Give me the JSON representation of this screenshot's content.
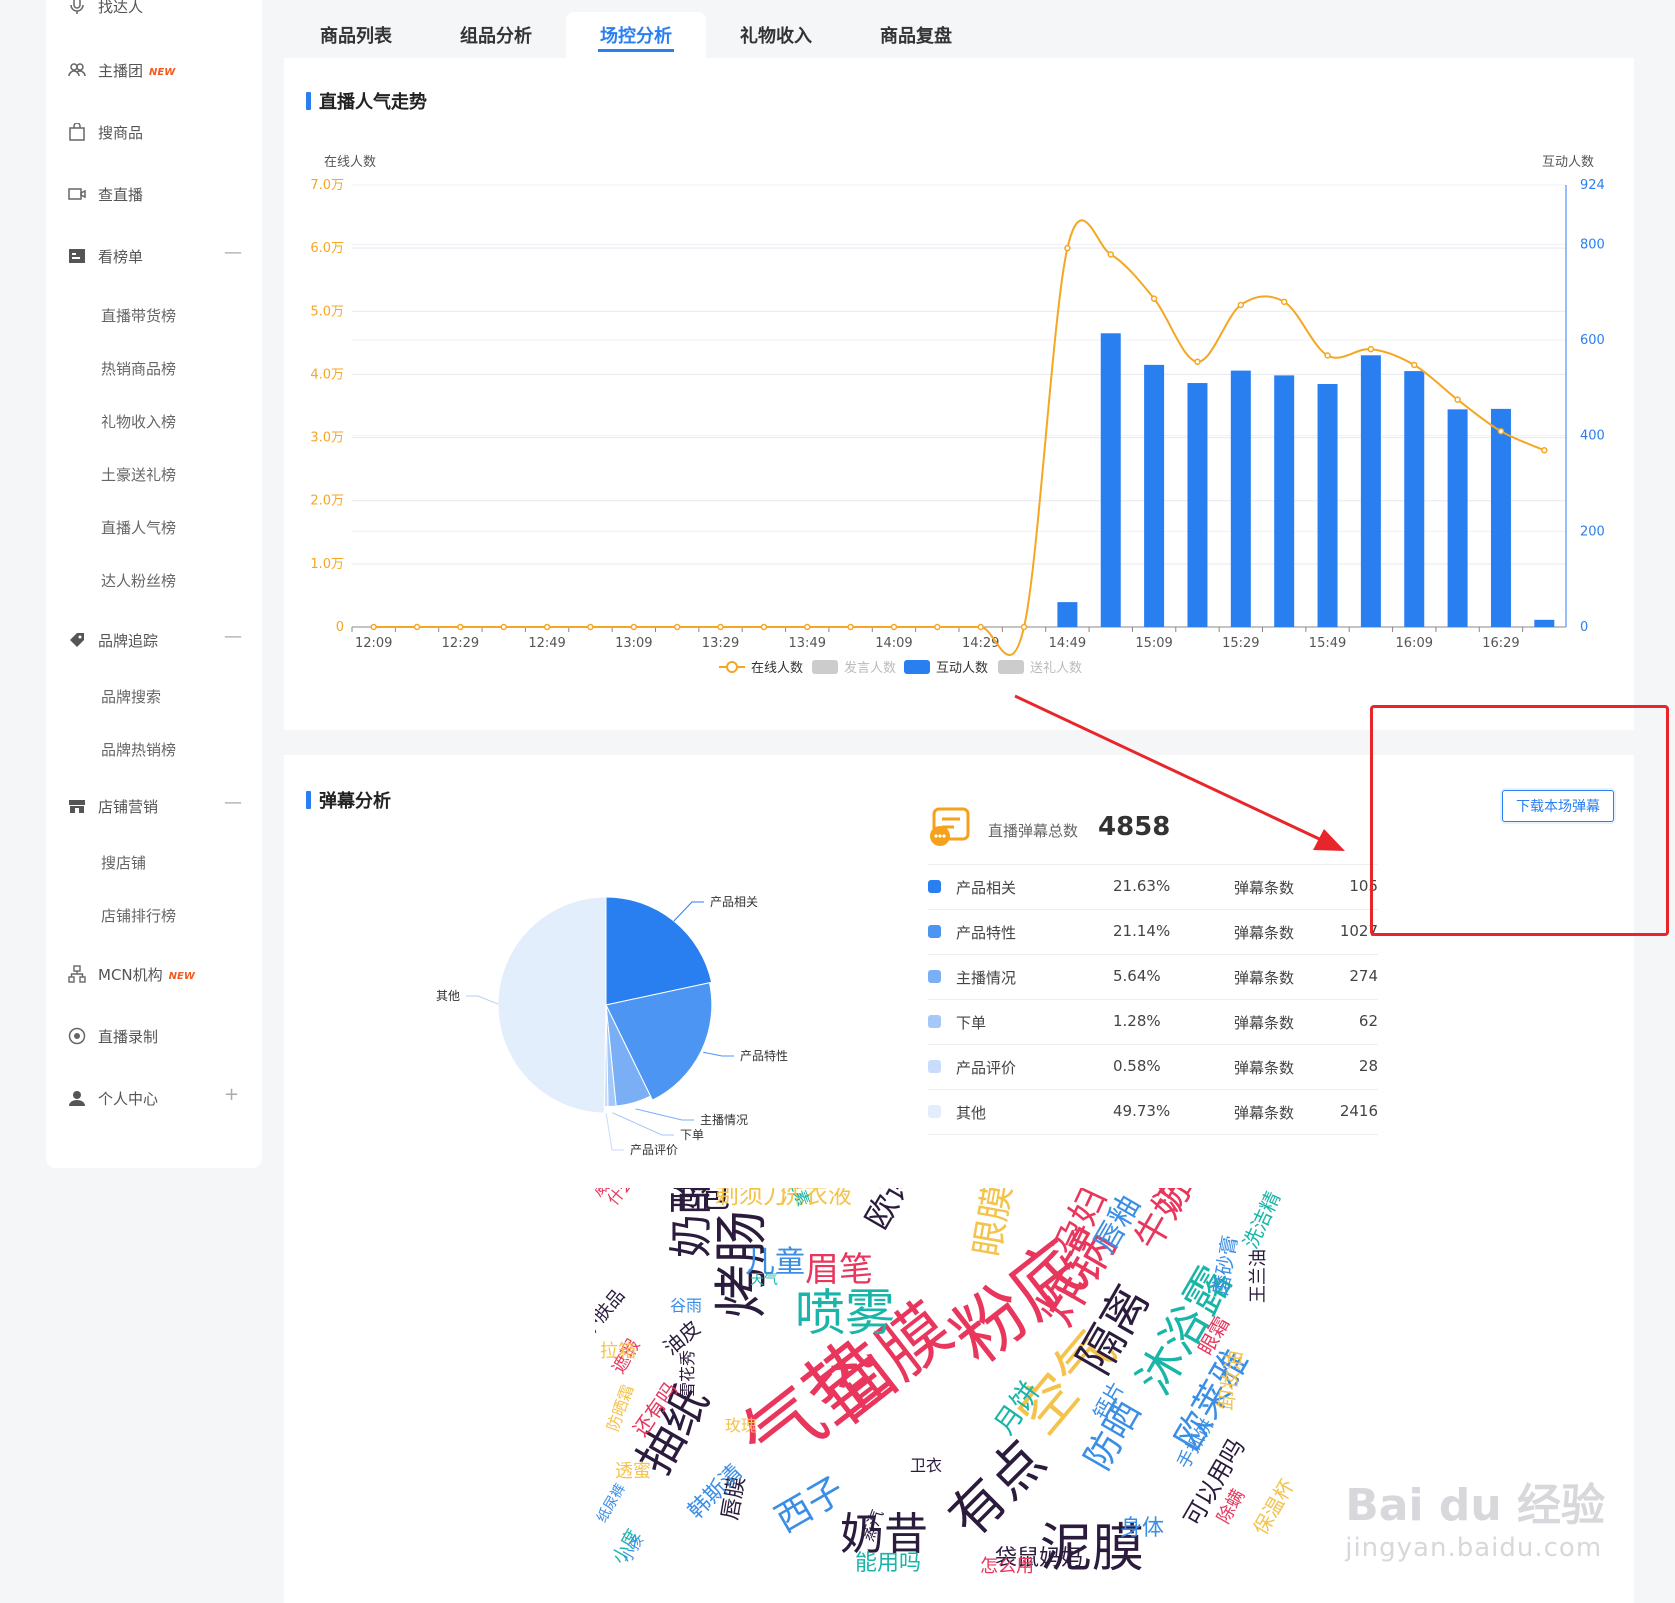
{
  "sidebar": {
    "items": [
      {
        "label": "找达人",
        "icon": "mic-icon"
      },
      {
        "label": "主播团",
        "icon": "group-icon",
        "badge": "NEW"
      },
      {
        "label": "搜商品",
        "icon": "bag-icon"
      },
      {
        "label": "查直播",
        "icon": "video-icon"
      },
      {
        "label": "看榜单",
        "icon": "ranking-icon",
        "toggle": "—"
      },
      {
        "label": "直播带货榜"
      },
      {
        "label": "热销商品榜"
      },
      {
        "label": "礼物收入榜"
      },
      {
        "label": "土豪送礼榜"
      },
      {
        "label": "直播人气榜"
      },
      {
        "label": "达人粉丝榜"
      },
      {
        "label": "品牌追踪",
        "icon": "tag-icon",
        "toggle": "—"
      },
      {
        "label": "品牌搜索"
      },
      {
        "label": "品牌热销榜"
      },
      {
        "label": "店铺营销",
        "icon": "store-icon",
        "toggle": "—"
      },
      {
        "label": "搜店铺"
      },
      {
        "label": "店铺排行榜"
      },
      {
        "label": "MCN机构",
        "icon": "org-icon",
        "badge": "NEW"
      },
      {
        "label": "直播录制",
        "icon": "record-icon"
      },
      {
        "label": "个人中心",
        "icon": "user-icon",
        "toggle": "+"
      }
    ]
  },
  "tabs": [
    "商品列表",
    "组品分析",
    "场控分析",
    "礼物收入",
    "商品复盘"
  ],
  "popularity": {
    "title": "直播人气走势",
    "left_axis_label": "在线人数",
    "right_axis_label": "互动人数",
    "legend": [
      "在线人数",
      "发言人数",
      "互动人数",
      "送礼人数"
    ]
  },
  "chart_data": {
    "type": "bar",
    "x": [
      "12:09",
      "12:19",
      "12:29",
      "12:39",
      "12:49",
      "12:59",
      "13:09",
      "13:19",
      "13:29",
      "13:39",
      "13:49",
      "13:59",
      "14:09",
      "14:19",
      "14:29",
      "14:39",
      "14:49",
      "14:59",
      "15:09",
      "15:19",
      "15:29",
      "15:39",
      "15:49",
      "15:59",
      "16:09",
      "16:19",
      "16:29",
      "16:39"
    ],
    "xticks": [
      "12:09",
      "12:29",
      "12:49",
      "13:09",
      "13:29",
      "13:49",
      "14:09",
      "14:29",
      "14:49",
      "15:09",
      "15:29",
      "15:49",
      "16:09",
      "16:29"
    ],
    "yleft_ticks": [
      "0",
      "1.0万",
      "2.0万",
      "3.0万",
      "4.0万",
      "5.0万",
      "6.0万",
      "7.0万"
    ],
    "yleft_lim": [
      0,
      70000
    ],
    "yright_ticks": [
      "0",
      "200",
      "400",
      "600",
      "800",
      "924"
    ],
    "yright_lim": [
      0,
      924
    ],
    "series": [
      {
        "name": "在线人数",
        "kind": "line",
        "axis": "left",
        "values": [
          0,
          0,
          0,
          0,
          0,
          0,
          0,
          0,
          0,
          0,
          0,
          0,
          0,
          0,
          0,
          0,
          60000,
          59000,
          52000,
          42000,
          51000,
          51500,
          43000,
          44000,
          41500,
          36000,
          31000,
          28000
        ]
      },
      {
        "name": "互动人数",
        "kind": "bar",
        "axis": "right",
        "values": [
          0,
          0,
          0,
          0,
          0,
          0,
          0,
          0,
          0,
          0,
          0,
          0,
          0,
          0,
          0,
          0,
          52,
          614,
          548,
          510,
          536,
          526,
          508,
          568,
          535,
          455,
          456,
          15
        ]
      }
    ]
  },
  "danmu": {
    "title": "弹幕分析",
    "total_label": "直播弹幕总数",
    "total_value": "4858",
    "download_label": "下载本场弹幕",
    "rows": [
      {
        "name": "产品相关",
        "pct": "21.63%",
        "label": "弹幕条数",
        "count": "105",
        "color": "#2a7ff0"
      },
      {
        "name": "产品特性",
        "pct": "21.14%",
        "label": "弹幕条数",
        "count": "1027",
        "color": "#4d95f3"
      },
      {
        "name": "主播情况",
        "pct": "5.64%",
        "label": "弹幕条数",
        "count": "274",
        "color": "#7aaff6"
      },
      {
        "name": "下单",
        "pct": "1.28%",
        "label": "弹幕条数",
        "count": "62",
        "color": "#a3c8f9"
      },
      {
        "name": "产品评价",
        "pct": "0.58%",
        "label": "弹幕条数",
        "count": "28",
        "color": "#c7ddfb"
      },
      {
        "name": "其他",
        "pct": "49.73%",
        "label": "弹幕条数",
        "count": "2416",
        "color": "#e3eefd"
      }
    ],
    "pie_labels": [
      "产品相关",
      "产品特性",
      "主播情况",
      "下单",
      "产品评价",
      "其他"
    ],
    "pie_values": [
      21.63,
      21.14,
      5.64,
      1.28,
      0.58,
      49.73
    ],
    "pie_colors": [
      "#2a7ff0",
      "#4d95f3",
      "#7aaff6",
      "#a3c8f9",
      "#c7ddfb",
      "#e3eefd"
    ]
  },
  "wordcloud": {
    "words": [
      {
        "t": "气垫",
        "c": "#e8365d"
      },
      {
        "t": "面膜",
        "c": "#e8365d"
      },
      {
        "t": "粉底",
        "c": "#e8365d"
      },
      {
        "t": "烤肠",
        "c": "#2b1b3d"
      },
      {
        "t": "喷雾",
        "c": "#19b5a8"
      },
      {
        "t": "奶酪",
        "c": "#2b1b3d"
      },
      {
        "t": "空气",
        "c": "#f4c34c"
      },
      {
        "t": "炸锅",
        "c": "#e8365d"
      },
      {
        "t": "隔离",
        "c": "#2b1b3d"
      },
      {
        "t": "沐浴露",
        "c": "#19b5a8"
      },
      {
        "t": "泥膜",
        "c": "#2b1b3d"
      },
      {
        "t": "奶昔",
        "c": "#2b1b3d"
      },
      {
        "t": "有点",
        "c": "#2b1b3d"
      },
      {
        "t": "抽纸",
        "c": "#2b1b3d"
      },
      {
        "t": "防晒",
        "c": "#3a8ee6"
      },
      {
        "t": "眉笔",
        "c": "#e8365d"
      },
      {
        "t": "眼膜",
        "c": "#f4c34c"
      },
      {
        "t": "孕妇",
        "c": "#e8365d"
      },
      {
        "t": "牛奶",
        "c": "#e8365d"
      },
      {
        "t": "洗手液",
        "c": "#e8365d"
      },
      {
        "t": "儿童",
        "c": "#3a8ee6"
      },
      {
        "t": "书包",
        "c": "#2b1b3d"
      },
      {
        "t": "欧诗漫",
        "c": "#2b1b3d"
      },
      {
        "t": "西子",
        "c": "#3a8ee6"
      },
      {
        "t": "欧莱雅",
        "c": "#3a8ee6"
      },
      {
        "t": "唇釉",
        "c": "#3a8ee6"
      },
      {
        "t": "洗衣液",
        "c": "#f4c34c"
      },
      {
        "t": "剃须刀",
        "c": "#f4c34c"
      },
      {
        "t": "月饼",
        "c": "#19b5a8"
      },
      {
        "t": "袋鼠妈妈",
        "c": "#2b1b3d"
      },
      {
        "t": "能用吗",
        "c": "#19b5a8"
      },
      {
        "t": "怎么用",
        "c": "#e8365d"
      },
      {
        "t": "身体",
        "c": "#3a8ee6"
      },
      {
        "t": "可以用吗",
        "c": "#2b1b3d"
      },
      {
        "t": "小度",
        "c": "#19b5a8"
      },
      {
        "t": "唇膜",
        "c": "#2b1b3d"
      },
      {
        "t": "韩斯清",
        "c": "#3a8ee6"
      },
      {
        "t": "还有吗",
        "c": "#e8365d"
      },
      {
        "t": "遮瑕",
        "c": "#e8365d"
      },
      {
        "t": "透蜜",
        "c": "#f4c34c"
      },
      {
        "t": "防晒霜",
        "c": "#f4c34c"
      },
      {
        "t": "拉箱",
        "c": "#f4c34c"
      },
      {
        "t": "护肤品",
        "c": "#2b1b3d"
      },
      {
        "t": "卸妆油",
        "c": "#f4c34c"
      },
      {
        "t": "眼霜",
        "c": "#e8365d"
      },
      {
        "t": "磨砂膏",
        "c": "#3a8ee6"
      },
      {
        "t": "洗洁精",
        "c": "#19b5a8"
      },
      {
        "t": "王兰油",
        "c": "#2b1b3d"
      },
      {
        "t": "脱毛膏",
        "c": "#2b1b3d"
      },
      {
        "t": "威露士",
        "c": "#e8365d"
      },
      {
        "t": "什么时候",
        "c": "#e8365d"
      },
      {
        "t": "涨工资",
        "c": "#f4c34c"
      },
      {
        "t": "自然堂",
        "c": "#e8365d"
      },
      {
        "t": "维生素",
        "c": "#19b5a8"
      },
      {
        "t": "抱抱",
        "c": "#19b5a8"
      },
      {
        "t": "去角质",
        "c": "#19b5a8"
      },
      {
        "t": "玫瑰",
        "c": "#f4c34c"
      },
      {
        "t": "卫衣",
        "c": "#2b1b3d"
      },
      {
        "t": "蒸汽",
        "c": "#2b1b3d"
      },
      {
        "t": "保温杯",
        "c": "#f4c34c"
      },
      {
        "t": "除螨",
        "c": "#e8365d"
      },
      {
        "t": "小孩",
        "c": "#3a8ee6"
      },
      {
        "t": "纸尿裤",
        "c": "#3a8ee6"
      },
      {
        "t": "雪花秀",
        "c": "#2b1b3d"
      },
      {
        "t": "油皮",
        "c": "#2b1b3d"
      },
      {
        "t": "谷雨",
        "c": "#3a8ee6"
      },
      {
        "t": "天气",
        "c": "#19b5a8"
      },
      {
        "t": "钙片",
        "c": "#3a8ee6"
      },
      {
        "t": "手抓饼",
        "c": "#3a8ee6"
      }
    ]
  },
  "watermark": {
    "main": "Bai du 经验",
    "sub": "jingyan.baidu.com"
  }
}
